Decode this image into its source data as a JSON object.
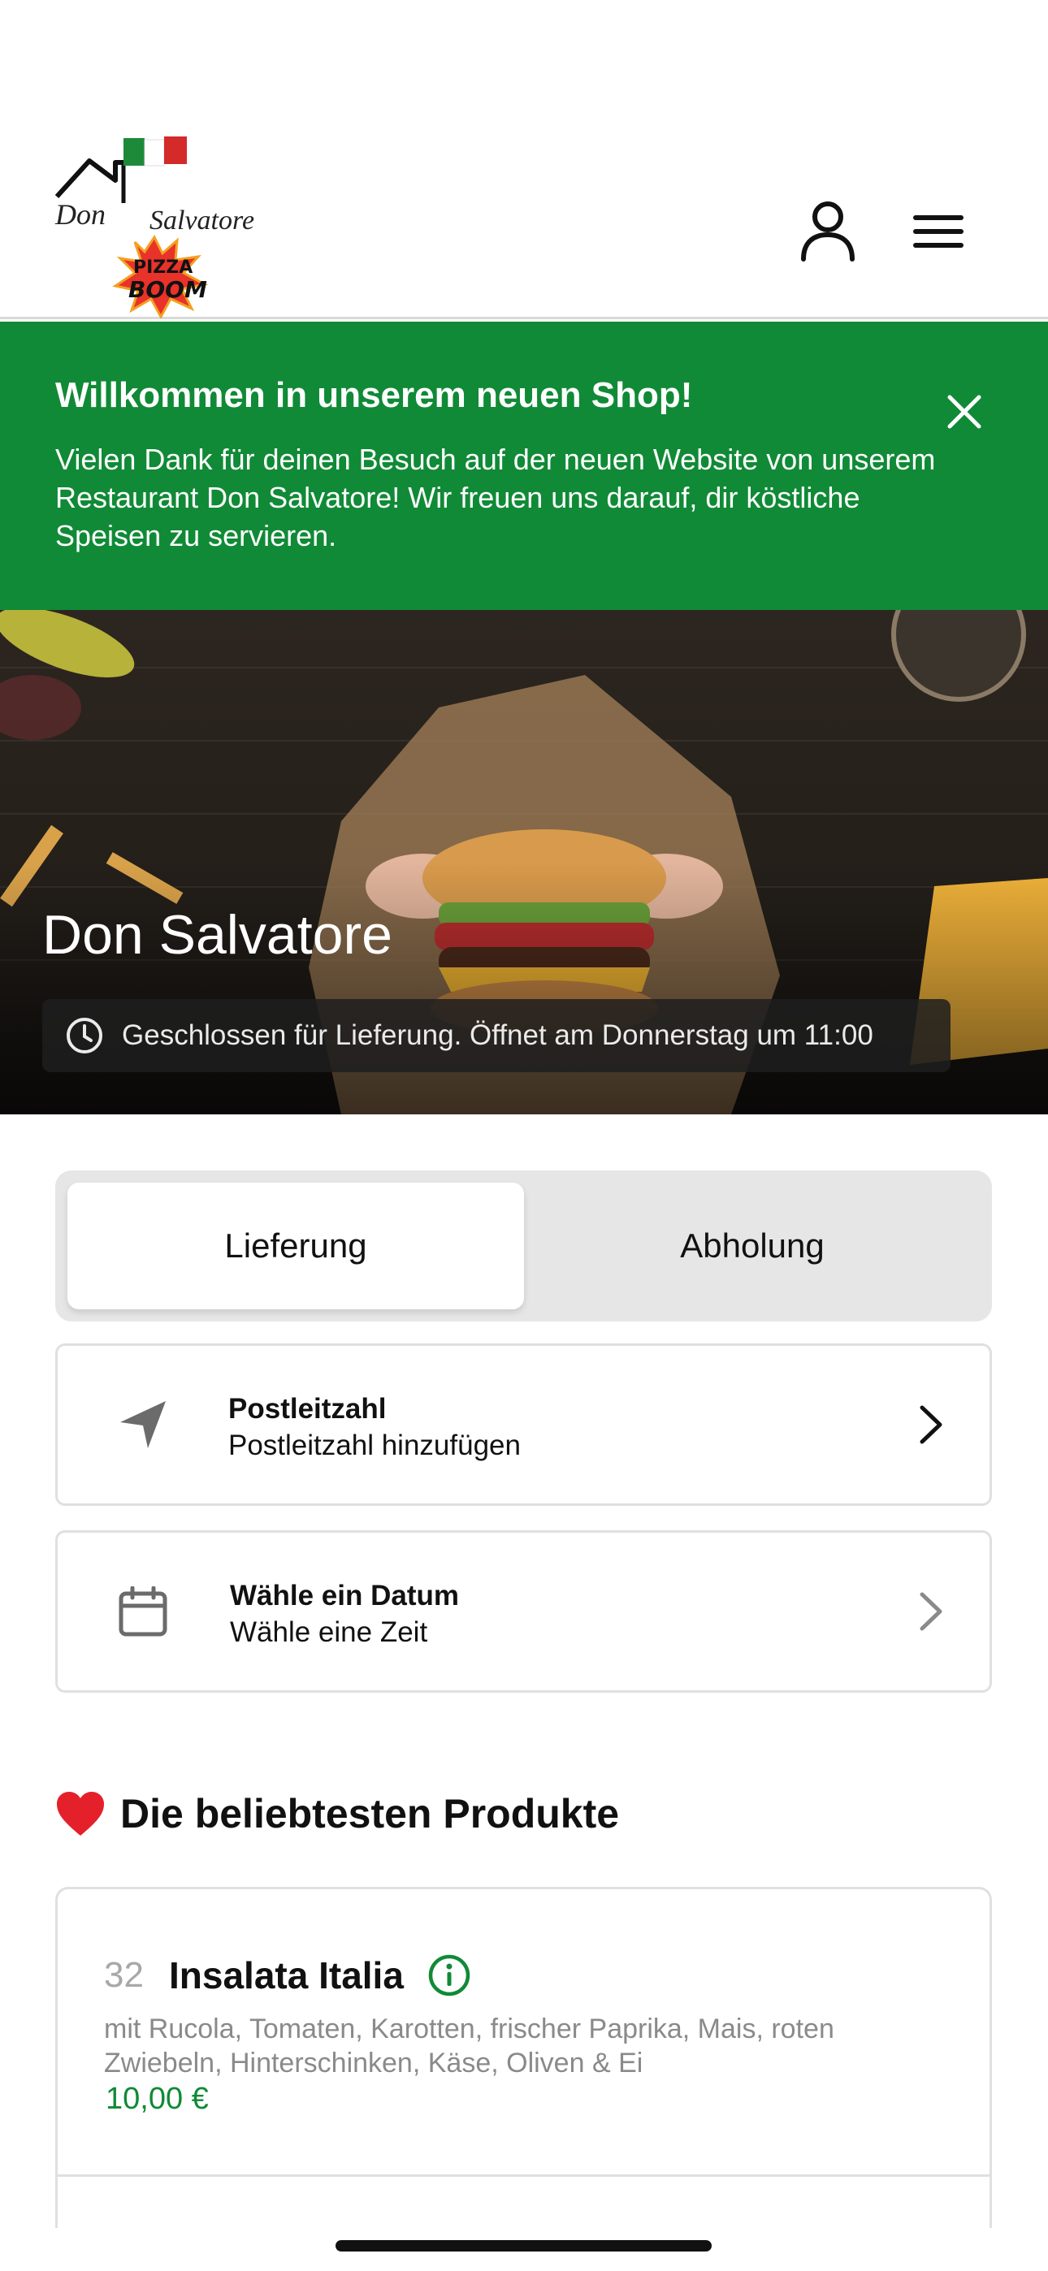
{
  "header": {
    "logo": {
      "brand_script": "Don Salvatore",
      "badge_line1": "PIZZA",
      "badge_line2": "BOOM"
    },
    "account_icon": "user-icon",
    "menu_icon": "hamburger-menu-icon"
  },
  "banner": {
    "title": "Willkommen in unserem neuen Shop!",
    "text": "Vielen Dank für deinen Besuch auf der neuen Website von unserem Restaurant Don Salvatore! Wir freuen uns darauf, dir köstliche Speisen zu servieren.",
    "close_icon": "close-icon",
    "background_color": "#108a36"
  },
  "hero": {
    "title": "Don Salvatore",
    "status": "Geschlossen für Lieferung. Öffnet am Donnerstag um 11:00",
    "status_icon": "clock-icon"
  },
  "order_mode": {
    "options": [
      "Lieferung",
      "Abholung"
    ],
    "selected": "Lieferung"
  },
  "postal": {
    "title": "Postleitzahl",
    "subtitle": "Postleitzahl hinzufügen",
    "icon": "location-arrow-icon"
  },
  "date": {
    "title": "Wähle ein Datum",
    "subtitle": "Wähle eine Zeit",
    "icon": "calendar-icon"
  },
  "popular": {
    "emoji": "❤️",
    "title": "Die beliebtesten Produkte",
    "products": [
      {
        "number": "32",
        "name": "Insalata Italia",
        "description": "mit Rucola, Tomaten, Karotten, frischer Paprika, Mais, roten Zwiebeln, Hinterschinken, Käse, Oliven & Ei",
        "price": "10,00 €"
      }
    ]
  },
  "colors": {
    "accent_green": "#108a36",
    "text_gray": "#8a8a8a"
  }
}
